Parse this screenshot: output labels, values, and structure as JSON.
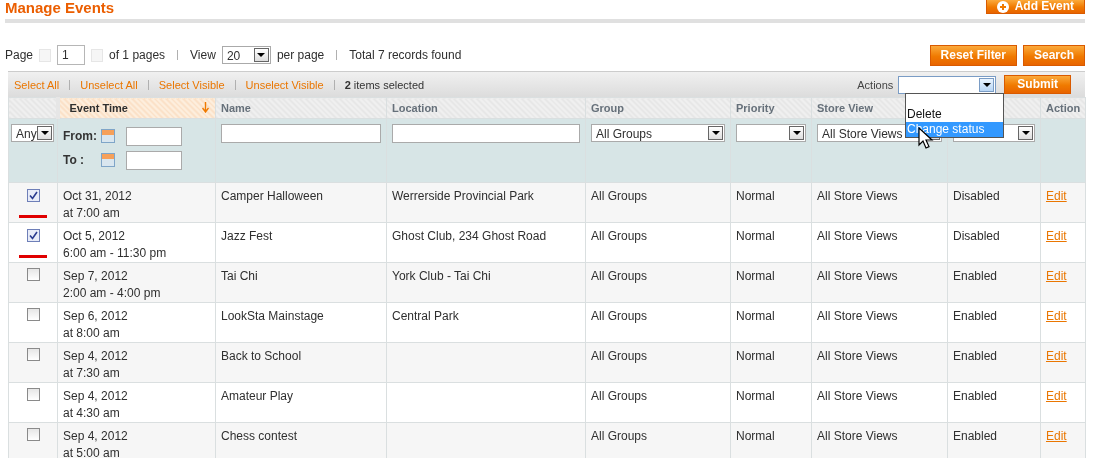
{
  "header": {
    "title": "Manage Events",
    "add_button": "Add Event"
  },
  "pager": {
    "page_label": "Page",
    "page": "1",
    "of_pages": "of 1 pages",
    "view_label": "View",
    "per_page": "20",
    "per_page_label": "per page",
    "total": "Total 7 records found"
  },
  "filter_buttons": [
    "Reset Filter",
    "Search"
  ],
  "massaction": {
    "links": [
      "Select All",
      "Unselect All",
      "Select Visible",
      "Unselect Visible"
    ],
    "count": "2",
    "count_label": "items selected",
    "actions_label": "Actions",
    "submit": "Submit",
    "options": [
      {
        "label": "Delete",
        "selected": false
      },
      {
        "label": "Change status",
        "selected": true
      }
    ]
  },
  "columns": [
    {
      "label": "Event Time",
      "sorted": true
    },
    {
      "label": "Name",
      "sorted": false
    },
    {
      "label": "Location",
      "sorted": false
    },
    {
      "label": "Group",
      "sorted": false
    },
    {
      "label": "Priority",
      "sorted": false
    },
    {
      "label": "Store View",
      "sorted": false
    },
    {
      "label": "Action",
      "sorted": false
    }
  ],
  "filters": {
    "any": "Any",
    "from": "From:",
    "to": "To :",
    "group": "All Groups",
    "store_view": "All Store Views"
  },
  "rows": [
    {
      "checked": true,
      "flagged": true,
      "date": "Oct 31, 2012",
      "time": "at 7:00 am",
      "name": "Camper Halloween",
      "location": "Werrerside Provincial Park",
      "group": "All Groups",
      "priority": "Normal",
      "store_view": "All Store Views",
      "status": "Disabled",
      "action": "Edit"
    },
    {
      "checked": true,
      "flagged": true,
      "date": "Oct 5, 2012",
      "time": "6:00 am - 11:30 pm",
      "name": "Jazz Fest",
      "location": "Ghost Club, 234 Ghost Road",
      "group": "All Groups",
      "priority": "Normal",
      "store_view": "All Store Views",
      "status": "Disabled",
      "action": "Edit"
    },
    {
      "checked": false,
      "flagged": false,
      "date": "Sep 7, 2012",
      "time": "2:00 am - 4:00 pm",
      "name": "Tai Chi",
      "location": "York Club - Tai Chi",
      "group": "All Groups",
      "priority": "Normal",
      "store_view": "All Store Views",
      "status": "Enabled",
      "action": "Edit"
    },
    {
      "checked": false,
      "flagged": false,
      "date": "Sep 6, 2012",
      "time": "at 8:00 am",
      "name": "LookSta Mainstage",
      "location": "Central Park",
      "group": "All Groups",
      "priority": "Normal",
      "store_view": "All Store Views",
      "status": "Enabled",
      "action": "Edit"
    },
    {
      "checked": false,
      "flagged": false,
      "date": "Sep 4, 2012",
      "time": "at 7:30 am",
      "name": "Back to School",
      "group": "All Groups",
      "priority": "Normal",
      "store_view": "All Store Views",
      "status": "Enabled",
      "action": "Edit"
    },
    {
      "checked": false,
      "flagged": false,
      "date": "Sep 4, 2012",
      "time": "at 4:30 am",
      "name": "Amateur Play",
      "group": "All Groups",
      "priority": "Normal",
      "store_view": "All Store Views",
      "status": "Enabled",
      "action": "Edit"
    },
    {
      "checked": false,
      "flagged": false,
      "date": "Sep 4, 2012",
      "time": "at 5:00 am",
      "name": "Chess contest",
      "group": "All Groups",
      "priority": "Normal",
      "store_view": "All Store Views",
      "status": "Enabled",
      "action": "Edit"
    }
  ]
}
